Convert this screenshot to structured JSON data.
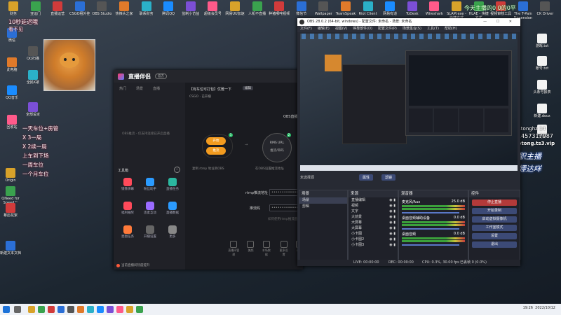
{
  "top_bar_icons": [
    {
      "label": "财务"
    },
    {
      "label": "亚运门"
    },
    {
      "label": "直播运营"
    },
    {
      "label": "CSGO租外挂"
    },
    {
      "label": "OBS Studio"
    },
    {
      "label": "热辣头之家"
    },
    {
      "label": "联系财务"
    },
    {
      "label": "腾讯QQ"
    },
    {
      "label": "监制小仿益"
    },
    {
      "label": "超级会员号"
    },
    {
      "label": "网易UU加速"
    },
    {
      "label": "人机不直播"
    },
    {
      "label": "种猪哪咤视频"
    },
    {
      "label": "微信节"
    },
    {
      "label": "Wallpaper"
    },
    {
      "label": "TeamSpeak"
    },
    {
      "label": "Riot Client"
    },
    {
      "label": "网易有道"
    },
    {
      "label": "ToDesk"
    },
    {
      "label": "Wireshark"
    },
    {
      "label": "SLAM.exe - 快捷方式"
    },
    {
      "label": "HLAE - 快捷方式"
    },
    {
      "label": "视频审核工具"
    },
    {
      "label": "The T-Pain Dimension"
    },
    {
      "label": "CK Driver"
    }
  ],
  "overlay": {
    "delay_text": "10秒延迟哦",
    "sub_text": "看不见",
    "queue_lines": [
      "一天车位+房管",
      "X 3一局",
      "X 2续一局",
      "上车到下场",
      "一周车位",
      "一个月车位"
    ],
    "top_right_text": "今天主播的0 0的0平",
    "qq_line1": "Btonghz 14",
    "qq_line2": "1457317987",
    "ts_line": "ts:btong.ts3.vip",
    "slogan1": "全职主播",
    "slogan2": "白嫖达咩"
  },
  "desktop_left_icons": [
    "微信",
    "QQ扫描",
    "此电脑",
    "全民K歌",
    "QQ音乐",
    "全部设定",
    "回收站",
    "Origin",
    "QNeed for Speed™",
    "幕后花絮",
    "新建文本文档"
  ],
  "desktop_right_icons": [
    "游戏.txt",
    "账号.txt",
    "头条号报表",
    "新建.docx",
    "文档"
  ],
  "live_app": {
    "logo": "直播伴侣",
    "version_badge": "官方",
    "tab_labels": [
      "热门",
      "场景",
      "直播"
    ],
    "notice": "OBS推流 - 仅支持连接已开启直播",
    "tools_header": "工具箱",
    "tools": [
      {
        "label": "镜像弹幕"
      },
      {
        "label": "粉丝助手"
      },
      {
        "label": "直播任务"
      },
      {
        "label": "福利抽奖"
      },
      {
        "label": "连麦互动"
      },
      {
        "label": "直播数据"
      },
      {
        "label": "星图任务"
      },
      {
        "label": "开播设置"
      },
      {
        "label": "更多"
      }
    ],
    "bottom_notice": "当前直播间热度提升",
    "stream_title": "【有车位可打包】优雅一下",
    "stream_meta": "CSGO · 已开播",
    "obs_label": "OBS直播",
    "step1": "开始",
    "step2": "推流",
    "rtmp_label": "RMS URL",
    "rtmp_sub": "推流/串码",
    "caption1": "复制 rtmp 地址到OBS",
    "caption2": "在OBS设置推流地址",
    "rtmp_addr_label": "rtmp推流地址",
    "stream_key_label": "推流码",
    "addr_value": "••••••••••••••••",
    "key_value": "••••••••••••••",
    "help_text": "如何使用rtmp推流直播",
    "bottom_icons": [
      "直播间管理",
      "美颜",
      "本场数据",
      "更多设置",
      "帮助"
    ]
  },
  "obs": {
    "title": "OBS 28.0.2 (64-bit, windows) - 配置文件: 未命名 - 场景: 未命名",
    "menu": [
      "文件(F)",
      "编辑(E)",
      "视图(V)",
      "停靠部件(D)",
      "配置文件(P)",
      "场景集合(S)",
      "工具(T)",
      "帮助(H)"
    ],
    "source_label": "未选择源",
    "prop_btn": "属性",
    "filter_btn": "滤镜",
    "scenes_header": "场景",
    "scenes": [
      "场景",
      "剪辑"
    ],
    "sources_header": "来源",
    "sources": [
      "直播编辑",
      "视频",
      "文字",
      "大前景",
      "大屏幕",
      "大屏幕",
      "小卡图",
      "小卡图2",
      "小卡图3"
    ],
    "mixer_header": "混音器",
    "mixer": [
      {
        "name": "麦克风/Aux",
        "db": "25.0 dB"
      },
      {
        "name": "桌面音频辅助设备",
        "db": "0.0 dB"
      },
      {
        "name": "桌面音频",
        "db": "0.0 dB"
      }
    ],
    "controls_header": "控件",
    "controls": [
      "停止直播",
      "开始录制",
      "启动虚拟摄像机",
      "工作室模式",
      "设置",
      "退出"
    ],
    "status": {
      "live": "LIVE: 00:00:00",
      "rec": "REC: 00:00:00",
      "cpu": "CPU: 0.3%, 30.00 fps",
      "kbps": "已丢帧 0 (0.0%)"
    }
  },
  "taskbar": {
    "time": "19:26",
    "date": "2022/10/12"
  },
  "colors": {
    "orange": "#f29b1f",
    "obs_red": "#b33a3a",
    "obs_blue": "#3c4a76",
    "red_text": "#ff3355"
  }
}
